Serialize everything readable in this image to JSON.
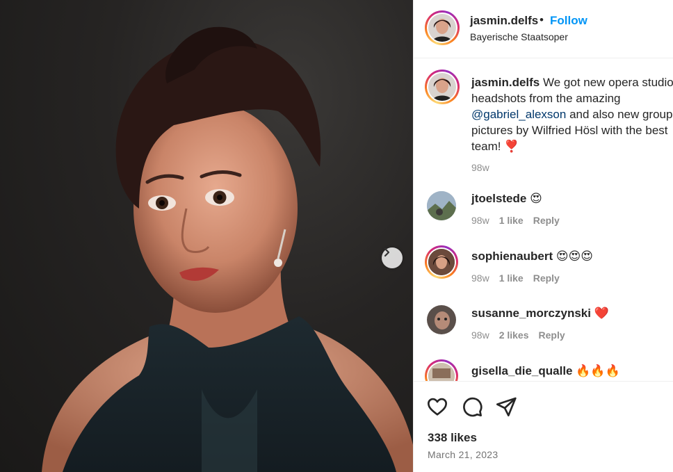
{
  "post": {
    "username": "jasmin.delfs",
    "separator": "•",
    "follow_label": "Follow",
    "location": "Bayerische Staatsoper",
    "more_label": "…"
  },
  "caption": {
    "username": "jasmin.delfs",
    "line1": "We got new opera studio",
    "line2": "headshots from the amazing",
    "mention": "@gabriel_alexson",
    "line3_rest": " and also new group",
    "line4": "pictures by Wilfried Hösl with the best",
    "line5": "team! ❣️",
    "time": "98w"
  },
  "comments": [
    {
      "username": "jtoelstede",
      "emoji": "😍",
      "time": "98w",
      "likes": "1 like",
      "reply": "Reply"
    },
    {
      "username": "sophienaubert",
      "emoji": "😍😍😍",
      "time": "98w",
      "likes": "1 like",
      "reply": "Reply"
    },
    {
      "username": "susanne_morczynski",
      "emoji": "❤️",
      "time": "98w",
      "likes": "2 likes",
      "reply": "Reply"
    },
    {
      "username": "gisella_die_qualle",
      "emoji": "🔥🔥🔥"
    }
  ],
  "footer": {
    "likes": "338 likes",
    "date": "March 21, 2023"
  },
  "icons": [
    "heart-icon",
    "comment-icon",
    "share-icon",
    "chevron-right-icon"
  ],
  "colors": {
    "follow": "#0095f6",
    "mention": "#00376b",
    "muted": "#8e8e8e"
  }
}
